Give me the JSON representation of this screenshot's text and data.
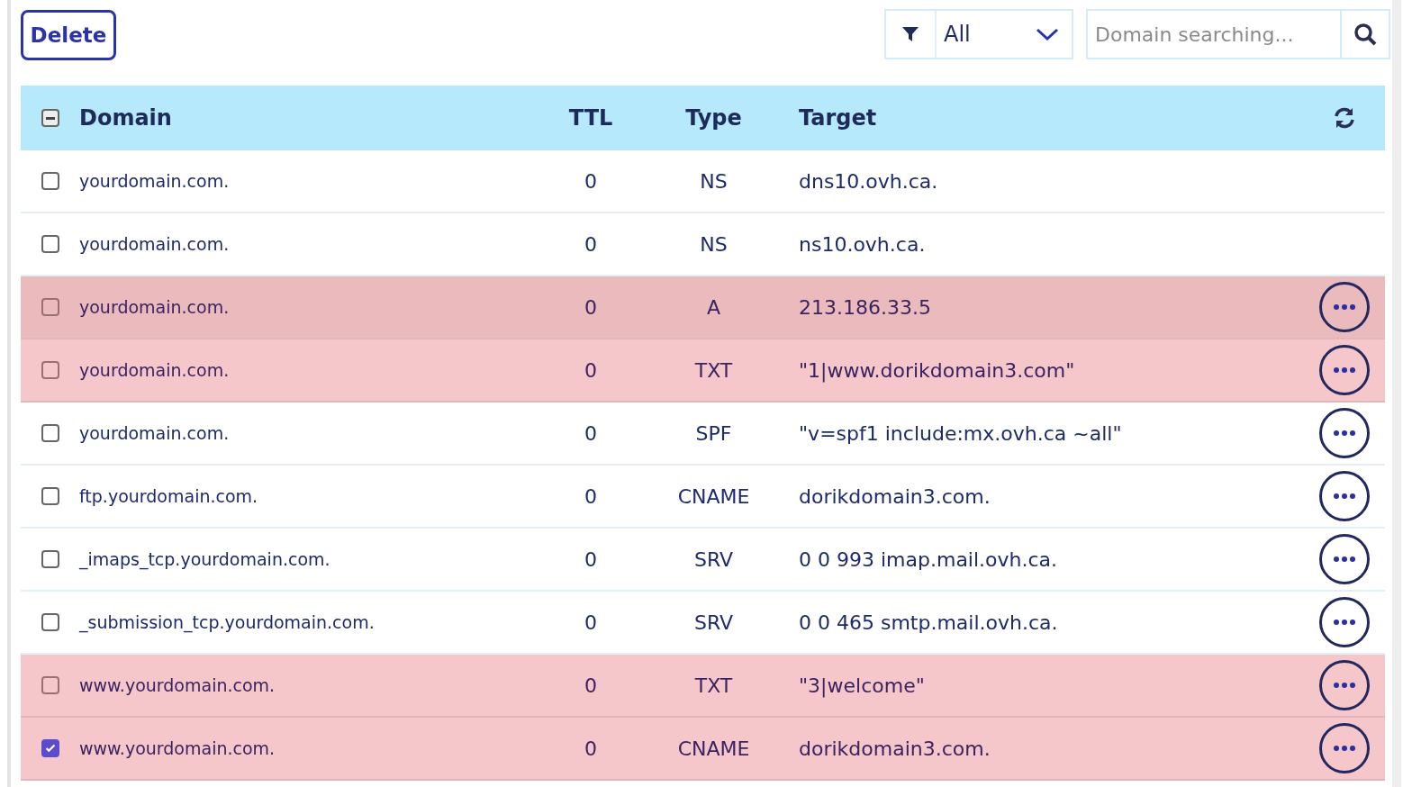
{
  "toolbar": {
    "delete_button": "Delete",
    "filter": {
      "value": "All"
    },
    "search": {
      "placeholder": "Domain searching..."
    }
  },
  "table": {
    "select_all": {
      "indeterminate": true
    },
    "columns": [
      "Domain",
      "TTL",
      "Type",
      "Target"
    ],
    "rows": [
      {
        "domain": "yourdomain.com.",
        "ttl": "0",
        "type": "NS",
        "target": "dns10.ovh.ca.",
        "checked": false,
        "highlighted": false,
        "hovered": false,
        "has_actions": false
      },
      {
        "domain": "yourdomain.com.",
        "ttl": "0",
        "type": "NS",
        "target": "ns10.ovh.ca.",
        "checked": false,
        "highlighted": false,
        "hovered": false,
        "has_actions": false
      },
      {
        "domain": "yourdomain.com.",
        "ttl": "0",
        "type": "A",
        "target": "213.186.33.5",
        "checked": false,
        "highlighted": true,
        "hovered": true,
        "has_actions": true
      },
      {
        "domain": "yourdomain.com.",
        "ttl": "0",
        "type": "TXT",
        "target": "\"1|www.dorikdomain3.com\"",
        "checked": false,
        "highlighted": true,
        "hovered": false,
        "has_actions": true
      },
      {
        "domain": "yourdomain.com.",
        "ttl": "0",
        "type": "SPF",
        "target": "\"v=spf1 include:mx.ovh.ca ~all\"",
        "checked": false,
        "highlighted": false,
        "hovered": false,
        "has_actions": true
      },
      {
        "domain": "ftp.yourdomain.com.",
        "ttl": "0",
        "type": "CNAME",
        "target": "dorikdomain3.com.",
        "checked": false,
        "highlighted": false,
        "hovered": false,
        "has_actions": true
      },
      {
        "domain": "_imaps_tcp.yourdomain.com.",
        "ttl": "0",
        "type": "SRV",
        "target": "0 0 993 imap.mail.ovh.ca.",
        "checked": false,
        "highlighted": false,
        "hovered": false,
        "has_actions": true
      },
      {
        "domain": "_submission_tcp.yourdomain.com.",
        "ttl": "0",
        "type": "SRV",
        "target": "0 0 465 smtp.mail.ovh.ca.",
        "checked": false,
        "highlighted": false,
        "hovered": false,
        "has_actions": true
      },
      {
        "domain": "www.yourdomain.com.",
        "ttl": "0",
        "type": "TXT",
        "target": "\"3|welcome\"",
        "checked": false,
        "highlighted": true,
        "hovered": false,
        "has_actions": true
      },
      {
        "domain": "www.yourdomain.com.",
        "ttl": "0",
        "type": "CNAME",
        "target": "dorikdomain3.com.",
        "checked": true,
        "highlighted": true,
        "hovered": false,
        "has_actions": true
      }
    ]
  }
}
